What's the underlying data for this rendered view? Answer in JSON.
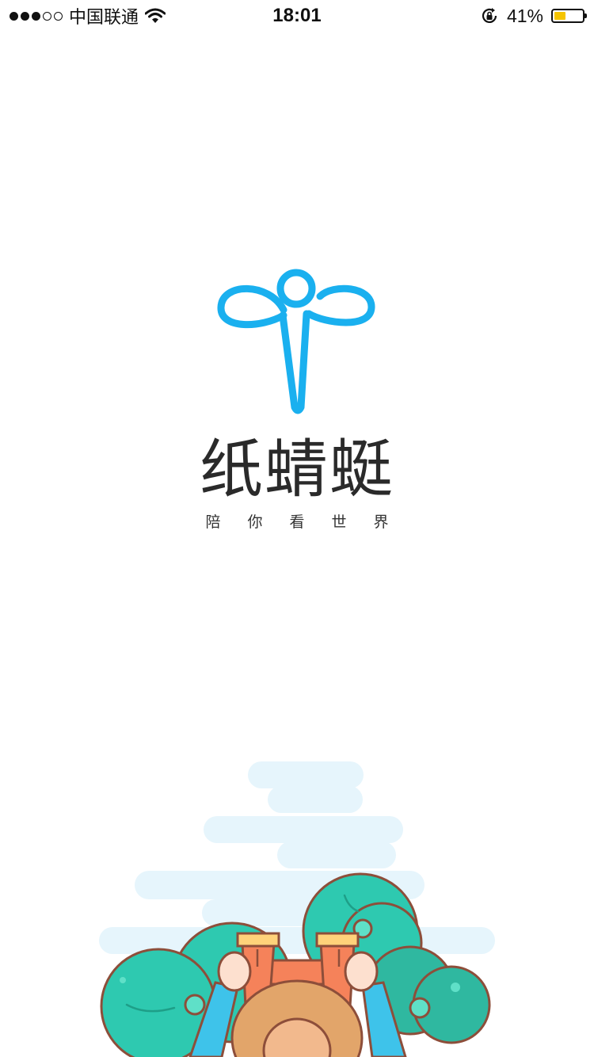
{
  "status_bar": {
    "carrier": "中国联通",
    "time": "18:01",
    "battery_percent": "41%",
    "battery_level": 0.41,
    "signal_bars_filled": 3,
    "signal_bars_total": 5,
    "icons": [
      "signal-dots-icon",
      "wifi-icon",
      "rotation-lock-icon",
      "battery-icon"
    ]
  },
  "splash": {
    "app_name": "纸蜻蜓",
    "tagline": "陪你看世界"
  },
  "colors": {
    "brand_blue": "#1ab0ef",
    "cloud": "#e6f5fc",
    "tree_teal": "#2ec9b0",
    "tree_dark": "#2fb8a0",
    "outline_brown": "#8d4e3a",
    "hat_tan": "#e2a56a",
    "jacket_blue": "#3ec3ea",
    "binocular_orange": "#f5825a",
    "battery_yellow": "#f5c400"
  }
}
